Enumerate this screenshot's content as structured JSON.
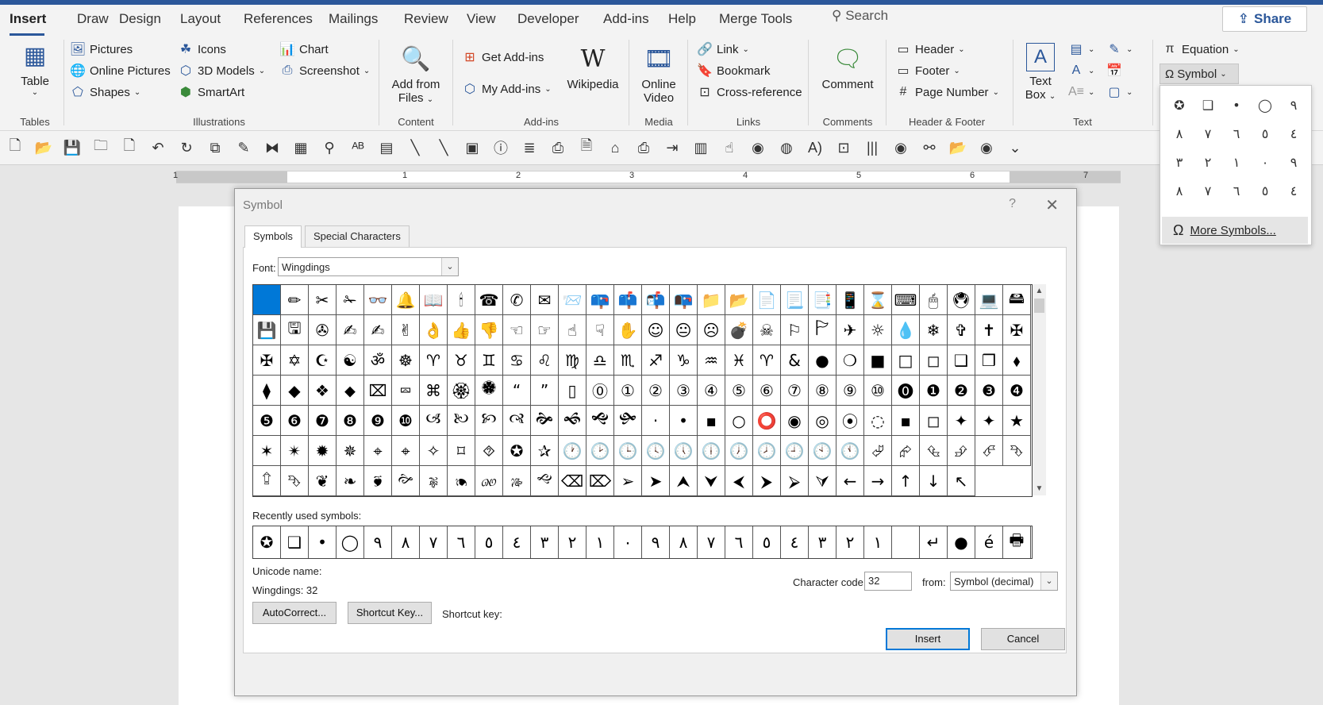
{
  "window": {
    "accent": "#2b579a"
  },
  "tabs": [
    "Insert",
    "Draw",
    "Design",
    "Layout",
    "References",
    "Mailings",
    "Review",
    "View",
    "Developer",
    "Add-ins",
    "Help",
    "Merge Tools"
  ],
  "search": {
    "label": "Search"
  },
  "share": {
    "label": "Share"
  },
  "ribbon": {
    "table": {
      "label": "Table",
      "group": "Tables"
    },
    "illustrations": {
      "pictures": "Pictures",
      "online_pictures": "Online Pictures",
      "shapes": "Shapes",
      "icons": "Icons",
      "models": "3D Models",
      "smartart": "SmartArt",
      "chart": "Chart",
      "screenshot": "Screenshot",
      "group": "Illustrations"
    },
    "content": {
      "add_from": "Add from",
      "files": "Files",
      "group": "Content"
    },
    "addins": {
      "get": "Get Add-ins",
      "my": "My Add-ins",
      "wikipedia": "Wikipedia",
      "group": "Add-ins"
    },
    "media": {
      "online": "Online",
      "video": "Video",
      "group": "Media"
    },
    "links": {
      "link": "Link",
      "bookmark": "Bookmark",
      "crossref": "Cross-reference",
      "group": "Links"
    },
    "comments": {
      "comment": "Comment",
      "group": "Comments"
    },
    "hf": {
      "header": "Header",
      "footer": "Footer",
      "page_number": "Page Number",
      "group": "Header & Footer"
    },
    "text": {
      "text": "Text",
      "box": "Box",
      "group": "Text"
    },
    "symbols": {
      "equation": "Equation",
      "symbol": "Symbol"
    }
  },
  "ruler": {
    "numbers": [
      "1",
      "1",
      "2",
      "3",
      "4",
      "5",
      "6",
      "7"
    ]
  },
  "dialog": {
    "title": "Symbol",
    "help": "?",
    "tabs": {
      "symbols": "Symbols",
      "special": "Special Characters"
    },
    "font_label": "Font:",
    "font_value": "Wingdings",
    "symbols": [
      " ",
      "✏",
      "✂",
      "✁",
      "👓",
      "🔔",
      "📖",
      "🕯",
      "☎",
      "✆",
      "✉",
      "📨",
      "📪",
      "📫",
      "📬",
      "📭",
      "📁",
      "📂",
      "📄",
      "📃",
      "📑",
      "📱",
      "⌛",
      "⌨",
      "🖱",
      "🖲",
      "💻",
      "🖴",
      "💾",
      "🖫",
      "✇",
      "✍",
      "✍",
      "✌",
      "👌",
      "👍",
      "👎",
      "☜",
      "☞",
      "☝",
      "☟",
      "✋",
      "☺",
      "😐",
      "☹",
      "💣",
      "☠",
      "⚐",
      "🏱",
      "✈",
      "☼",
      "💧",
      "❄",
      "✞",
      "✝",
      "✠",
      "✠",
      "✡",
      "☪",
      "☯",
      "ॐ",
      "☸",
      "♈",
      "♉",
      "♊",
      "♋",
      "♌",
      "♍",
      "♎",
      "♏",
      "♐",
      "♑",
      "♒",
      "♓",
      "♈",
      "&",
      "●",
      "❍",
      "■",
      "□",
      "◻",
      "❑",
      "❒",
      "⬧",
      "⧫",
      "◆",
      "❖",
      "⬥",
      "⌧",
      "⮹",
      "⌘",
      "🏵",
      "🏶",
      "“",
      "”",
      "▯",
      "⓪",
      "①",
      "②",
      "③",
      "④",
      "⑤",
      "⑥",
      "⑦",
      "⑧",
      "⑨",
      "⑩",
      "⓿",
      "❶",
      "❷",
      "❸",
      "❹",
      "❺",
      "❻",
      "❼",
      "❽",
      "❾",
      "❿",
      "🙢",
      "🙠",
      "🙡",
      "🙣",
      "🙞",
      "🙜",
      "🙝",
      "🙟",
      "·",
      "•",
      "▪",
      "○",
      "⭕",
      "◉",
      "◎",
      "⦿",
      "◌",
      "▪",
      "◻",
      "✦",
      "✦",
      "★",
      "✶",
      "✴",
      "✹",
      "✵",
      "⌖",
      "⌖",
      "✧",
      "⌑",
      "⯑",
      "✪",
      "✰",
      "🕐",
      "🕑",
      "🕒",
      "🕓",
      "🕔",
      "🕕",
      "🕖",
      "🕗",
      "🕘",
      "🕙",
      "🕚",
      "⮰",
      "⮳",
      "⮴",
      "⮵",
      "⮶",
      "⮷",
      "⮸",
      "⮷",
      "❦",
      "❧",
      "🙘",
      "🙚",
      "🙖",
      "🙔",
      "🙐",
      "🙓",
      "🙙",
      "⌫",
      "⌦",
      "➢",
      "➤",
      "⮝",
      "⮟",
      "⮜",
      "⮞",
      "⮚",
      "⮛",
      "←",
      "→",
      "↑",
      "↓",
      "↖"
    ],
    "recent_label": "Recently used symbols:",
    "recent": [
      "✪",
      "❑",
      "•",
      "◯",
      "٩",
      "٨",
      "٧",
      "٦",
      "٥",
      "٤",
      "٣",
      "٢",
      "١",
      "٠",
      "٩",
      "٨",
      "٧",
      "٦",
      "٥",
      "٤",
      "٣",
      "٢",
      "١",
      " ",
      "↵",
      "●",
      "é",
      "🖶"
    ],
    "unicode_name_label": "Unicode name:",
    "unicode_value": "Wingdings: 32",
    "char_code_label": "Character code:",
    "char_code": "32",
    "from_label": "from:",
    "from_value": "Symbol (decimal)",
    "autocorrect": "AutoCorrect...",
    "shortcut_btn": "Shortcut Key...",
    "shortcut_label": "Shortcut key:",
    "insert": "Insert",
    "cancel": "Cancel"
  },
  "symbol_popup": {
    "items": [
      "✪",
      "❑",
      "•",
      "◯",
      "٩",
      "٨",
      "٧",
      "٦",
      "٥",
      "٤",
      "٣",
      "٢",
      "١",
      "٠",
      "٩",
      "٨",
      "٧",
      "٦",
      "٥",
      "٤"
    ],
    "more": "More Symbols..."
  }
}
